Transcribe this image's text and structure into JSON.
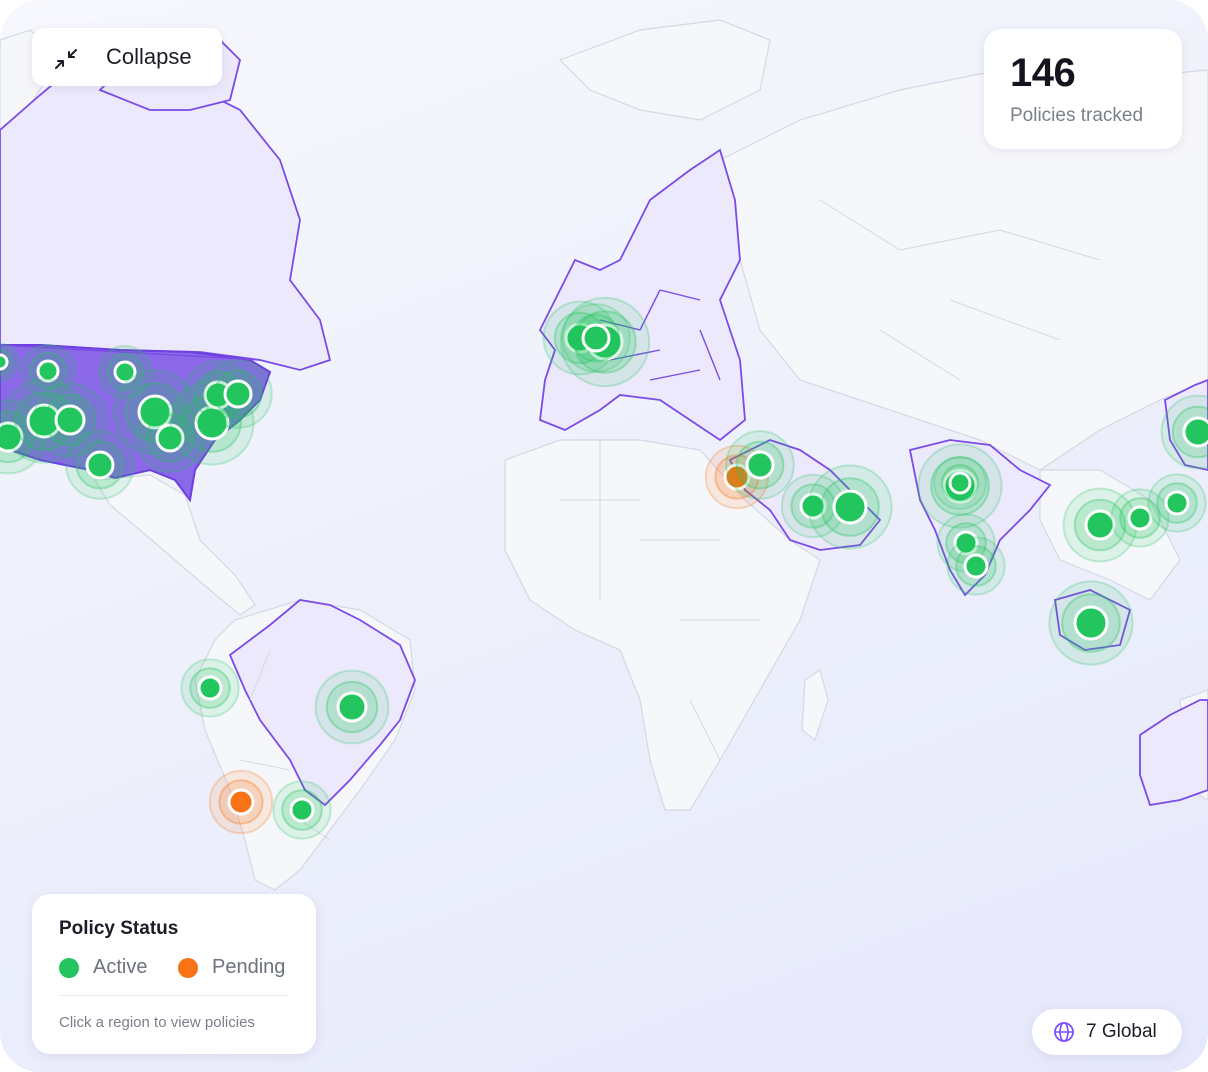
{
  "header": {
    "collapse_label": "Collapse",
    "collapse_icon": "collapse-arrows-icon"
  },
  "stats": {
    "count": "146",
    "label": "Policies tracked"
  },
  "legend": {
    "title": "Policy Status",
    "items": [
      {
        "label": "Active",
        "color": "#22c55e"
      },
      {
        "label": "Pending",
        "color": "#f97316"
      }
    ],
    "hint": "Click a region to view policies"
  },
  "global": {
    "icon": "globe-icon",
    "label": "7 Global"
  },
  "colors": {
    "active": "#22c55e",
    "pending": "#f97316",
    "highlight_region": "#7c4dff",
    "us_fill": "#8a68e8"
  },
  "highlighted_regions": [
    "United States",
    "Canada",
    "Greenland",
    "Europe",
    "Brazil",
    "Middle East",
    "India",
    "Indonesia",
    "Japan",
    "Australia"
  ],
  "markers": [
    {
      "status": "active"
    },
    {
      "status": "active"
    },
    {
      "status": "active"
    },
    {
      "status": "active"
    },
    {
      "status": "active"
    },
    {
      "status": "active"
    },
    {
      "status": "active"
    },
    {
      "status": "active"
    },
    {
      "status": "active"
    },
    {
      "status": "active"
    },
    {
      "status": "active"
    },
    {
      "status": "active"
    },
    {
      "status": "active"
    },
    {
      "status": "active"
    },
    {
      "status": "active"
    },
    {
      "status": "active"
    },
    {
      "status": "pending"
    },
    {
      "status": "active"
    },
    {
      "status": "active"
    },
    {
      "status": "active"
    },
    {
      "status": "active"
    },
    {
      "status": "active"
    },
    {
      "status": "active"
    },
    {
      "status": "active"
    },
    {
      "status": "active"
    },
    {
      "status": "active"
    },
    {
      "status": "active"
    },
    {
      "status": "active"
    },
    {
      "status": "active"
    },
    {
      "status": "active"
    },
    {
      "status": "pending"
    },
    {
      "status": "active"
    }
  ]
}
